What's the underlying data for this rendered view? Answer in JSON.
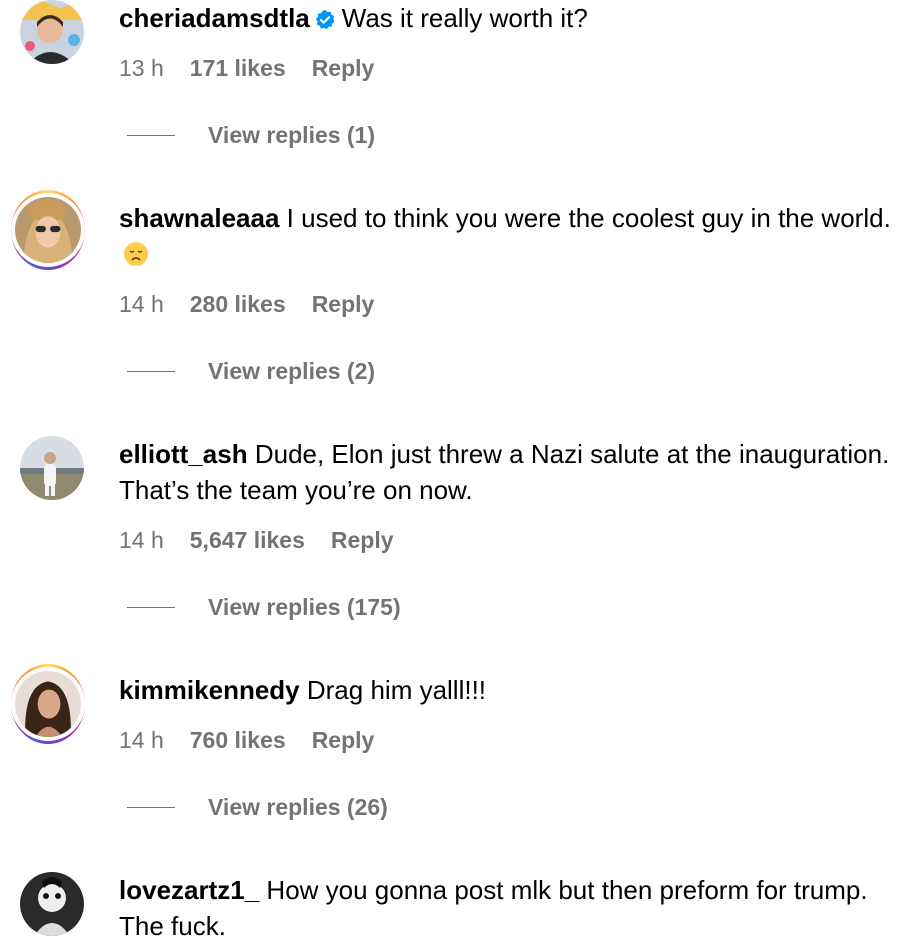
{
  "comments": [
    {
      "username": "cheriadamsdtla",
      "verified": true,
      "text": "Was it really worth it?",
      "time": "13 h",
      "likes": "171 likes",
      "reply": "Reply",
      "view_replies": "View replies (1)"
    },
    {
      "username": "shawnaleaaa",
      "story_ring": true,
      "text": "I used to think you were the coolest guy in the world.",
      "emoji": "disappointed-face",
      "time": "14 h",
      "likes": "280 likes",
      "reply": "Reply",
      "view_replies": "View replies (2)"
    },
    {
      "username": "elliott_ash",
      "text": "Dude, Elon just threw a Nazi salute at the inauguration. That’s the team you’re on now.",
      "time": "14 h",
      "likes": "5,647 likes",
      "reply": "Reply",
      "view_replies": "View replies (175)"
    },
    {
      "username": "kimmikennedy",
      "story_ring": true,
      "text": "Drag him yalll!!!",
      "time": "14 h",
      "likes": "760 likes",
      "reply": "Reply",
      "view_replies": "View replies (26)"
    },
    {
      "username": "lovezartz1_",
      "text": "How you gonna post mlk but then preform for trump. The fuck."
    }
  ],
  "colors": {
    "meta_gray": "#737373",
    "verified_blue": "#0095f6"
  }
}
